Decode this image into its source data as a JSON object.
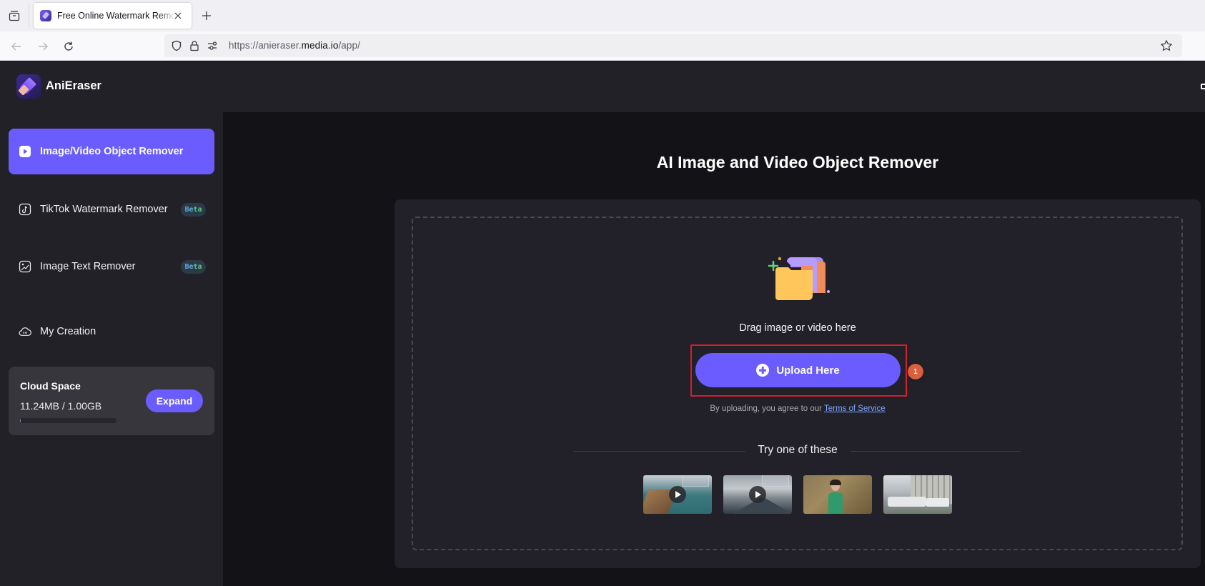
{
  "browser": {
    "tab_title": "Free Online Watermark Remover",
    "url_prefix": "https://anieraser.",
    "url_domain": "media.io",
    "url_suffix": "/app/"
  },
  "app": {
    "brand": "AniEraser"
  },
  "sidebar": {
    "items": [
      {
        "label": "Image/Video Object Remover",
        "active": true,
        "icon": "play-square-icon"
      },
      {
        "label": "TikTok Watermark Remover",
        "badge": "Beta",
        "icon": "tiktok-icon"
      },
      {
        "label": "Image Text Remover",
        "badge": "Beta",
        "icon": "image-text-icon"
      }
    ],
    "my_creation": {
      "label": "My Creation",
      "icon": "cloud-icon"
    },
    "cloud": {
      "title": "Cloud Space",
      "usage": "11.24MB / 1.00GB",
      "used_fraction": 0.011,
      "expand_label": "Expand"
    }
  },
  "main": {
    "title": "AI Image and Video Object Remover",
    "drag_text": "Drag image or video here",
    "upload_label": "Upload Here",
    "step_badge": "1",
    "terms_prefix": "By uploading, you agree to our ",
    "terms_link": "Terms of Service",
    "try_label": "Try one of these",
    "samples": [
      {
        "name": "coast-video",
        "type": "video"
      },
      {
        "name": "volcano-video",
        "type": "video"
      },
      {
        "name": "woman-portrait-image",
        "type": "image"
      },
      {
        "name": "city-bus-image",
        "type": "image"
      }
    ]
  },
  "colors": {
    "accent": "#6a5cff",
    "highlight_box": "#d0202a",
    "step_badge": "#d9603c",
    "link": "#7fa6ff"
  }
}
